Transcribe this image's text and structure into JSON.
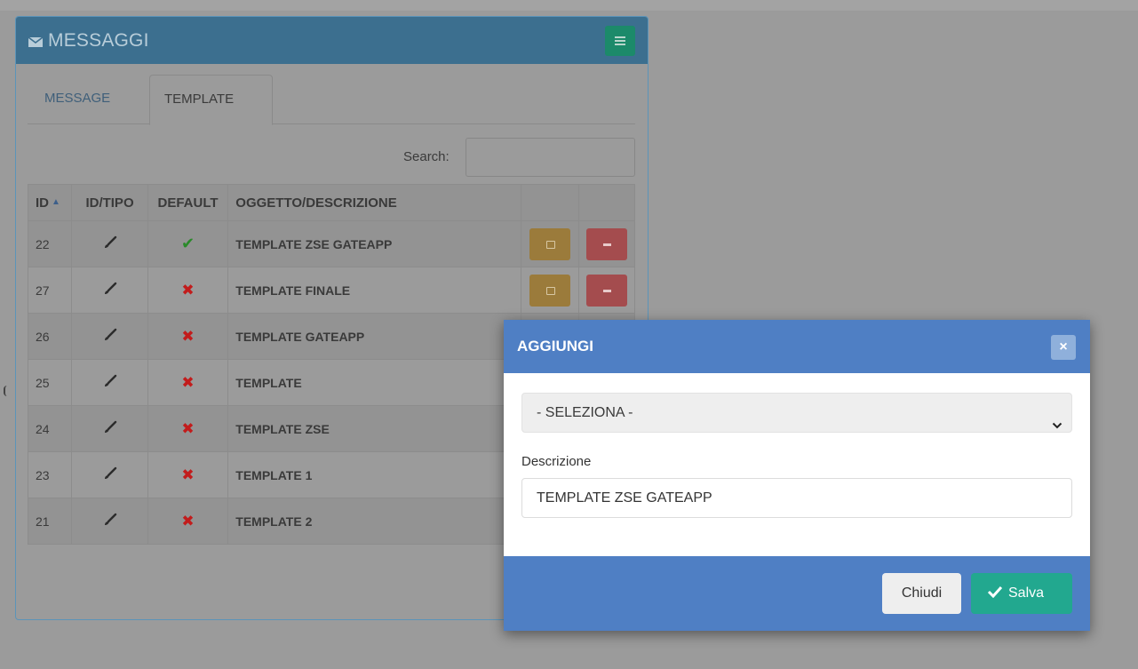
{
  "panel": {
    "title": "MESSAGGI",
    "icon": "envelope-icon",
    "menu_icon": "hamburger-menu-icon"
  },
  "tabs": [
    {
      "label": "MESSAGE",
      "active": false
    },
    {
      "label": "TEMPLATE",
      "active": true
    }
  ],
  "search": {
    "label": "Search:",
    "value": ""
  },
  "table": {
    "columns": [
      "ID",
      "ID/TIPO",
      "DEFAULT",
      "OGGETTO/DESCRIZIONE",
      "",
      ""
    ],
    "sort_column": "ID",
    "sort_direction": "ascending",
    "rows": [
      {
        "id": "22",
        "tipo_icon": "brush-icon",
        "default": true,
        "description": "TEMPLATE ZSE GATEAPP"
      },
      {
        "id": "27",
        "tipo_icon": "brush-icon",
        "default": false,
        "description": "TEMPLATE FINALE"
      },
      {
        "id": "26",
        "tipo_icon": "brush-icon",
        "default": false,
        "description": "TEMPLATE GATEAPP"
      },
      {
        "id": "25",
        "tipo_icon": "brush-icon",
        "default": false,
        "description": "TEMPLATE"
      },
      {
        "id": "24",
        "tipo_icon": "brush-icon",
        "default": false,
        "description": "TEMPLATE ZSE"
      },
      {
        "id": "23",
        "tipo_icon": "brush-icon",
        "default": false,
        "description": "TEMPLATE 1"
      },
      {
        "id": "21",
        "tipo_icon": "brush-icon",
        "default": false,
        "description": "TEMPLATE 2"
      }
    ],
    "row_actions": [
      "edit-icon",
      "minus-icon"
    ]
  },
  "modal": {
    "title": "AGGIUNGI",
    "close_symbol": "×",
    "select": {
      "selected": "- SELEZIONA -"
    },
    "description_label": "Descrizione",
    "description_value": "TEMPLATE ZSE GATEAPP",
    "cancel_label": "Chiudi",
    "save_label": "Salva"
  },
  "colors": {
    "panel_header": "#3c6f8f",
    "modal_header": "#4f7fc4",
    "save_button": "#22a88f",
    "edit_button": "#9b7b3b",
    "delete_button": "#a44c4e"
  }
}
